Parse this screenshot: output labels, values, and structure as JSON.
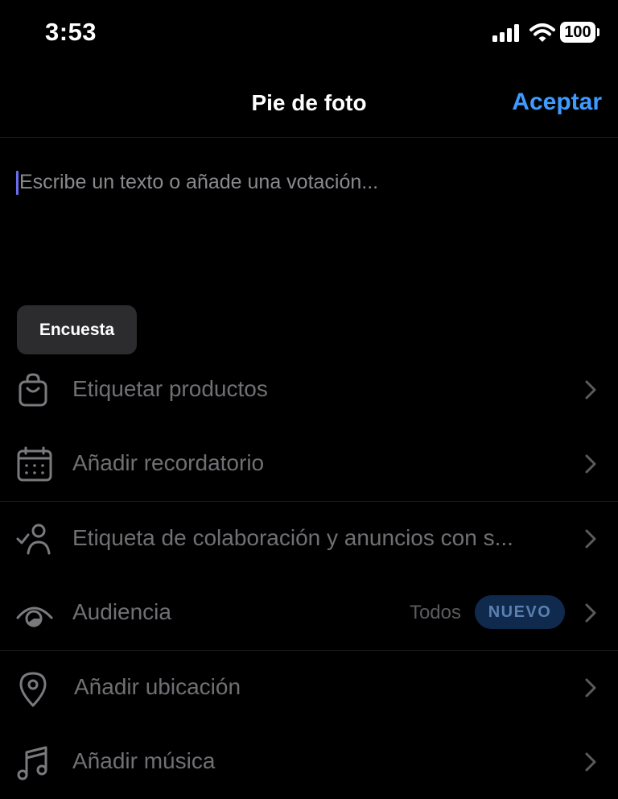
{
  "status_bar": {
    "time": "3:53",
    "battery": "100"
  },
  "nav": {
    "title": "Pie de foto",
    "accept_label": "Aceptar"
  },
  "caption": {
    "placeholder": "Escribe un texto o añade una votación...",
    "value": ""
  },
  "poll_button": {
    "label": "Encuesta"
  },
  "options": [
    {
      "label": "Etiquetar productos",
      "icon": "shopping-bag-icon"
    },
    {
      "label": "Añadir recordatorio",
      "icon": "calendar-icon"
    },
    {
      "label": "Etiqueta de colaboración y anuncios con s...",
      "icon": "person-check-icon"
    },
    {
      "label": "Audiencia",
      "icon": "eye-icon",
      "value": "Todos",
      "badge": "NUEVO"
    },
    {
      "label": "Añadir ubicación",
      "icon": "location-pin-icon"
    },
    {
      "label": "Añadir música",
      "icon": "music-note-icon"
    }
  ],
  "colors": {
    "accent": "#3e9bff",
    "background": "#000000",
    "badge_bg": "#0f2a4d",
    "cursor": "#6a6cf0"
  }
}
